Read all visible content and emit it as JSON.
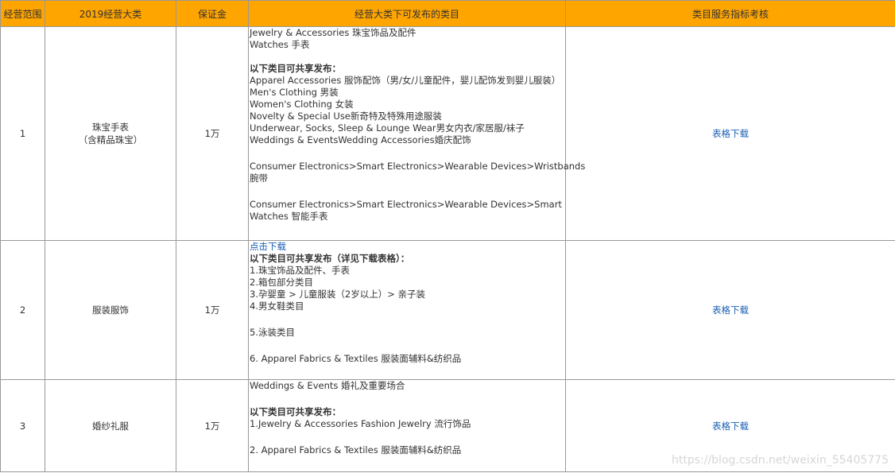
{
  "headers": [
    "经营范围",
    "2019经营大类",
    "保证金",
    "经营大类下可发布的类目",
    "类目服务指标考核"
  ],
  "rows": [
    {
      "num": "1",
      "cat1": "珠宝手表",
      "cat2": "（含精品珠宝）",
      "deposit": "1万",
      "link": "表格下载",
      "content": {
        "l1": "Jewelry & Accessories 珠宝饰品及配件",
        "l2": "Watches 手表",
        "share": "以下类目可共享发布：",
        "s1": "Apparel Accessories 服饰配饰（男/女/儿童配件，婴儿配饰发到婴儿服装）",
        "s2": "Men's Clothing 男装",
        "s3": "Women's Clothing 女装",
        "s4": "Novelty & Special Use新奇特及特殊用途服装",
        "s5": "Underwear, Socks, Sleep & Lounge Wear男女内衣/家居服/袜子",
        "s6": "Weddings & EventsWedding Accessories婚庆配饰",
        "e1a": "Consumer Electronics>Smart Electronics>Wearable Devices>Wristbands",
        "e1b": "腕带",
        "e2a": "Consumer Electronics>Smart Electronics>Wearable Devices>Smart",
        "e2b": "Watches 智能手表"
      }
    },
    {
      "num": "2",
      "cat1": "服装服饰",
      "deposit": "1万",
      "link": "表格下载",
      "content": {
        "click": "点击下载",
        "share": "以下类目可共享发布（详见下载表格）：",
        "s1": "1.珠宝饰品及配件、手表",
        "s2": "2.箱包部分类目",
        "s3": "3.孕婴童 > 儿童服装（2岁以上）> 亲子装",
        "s4": "4.男女鞋类目",
        "s5": "5.泳装类目",
        "s6": "6. Apparel Fabrics & Textiles 服装面辅料&纺织品"
      }
    },
    {
      "num": "3",
      "cat1": "婚纱礼服",
      "deposit": "1万",
      "link": "表格下载",
      "content": {
        "l1": "Weddings & Events    婚礼及重要场合",
        "share": "以下类目可共享发布：",
        "s1": "1.Jewelry & Accessories Fashion Jewelry 流行饰品",
        "s2": "2. Apparel Fabrics & Textiles 服装面辅料&纺织品"
      }
    }
  ],
  "watermark": "https://blog.csdn.net/weixin_55405775"
}
